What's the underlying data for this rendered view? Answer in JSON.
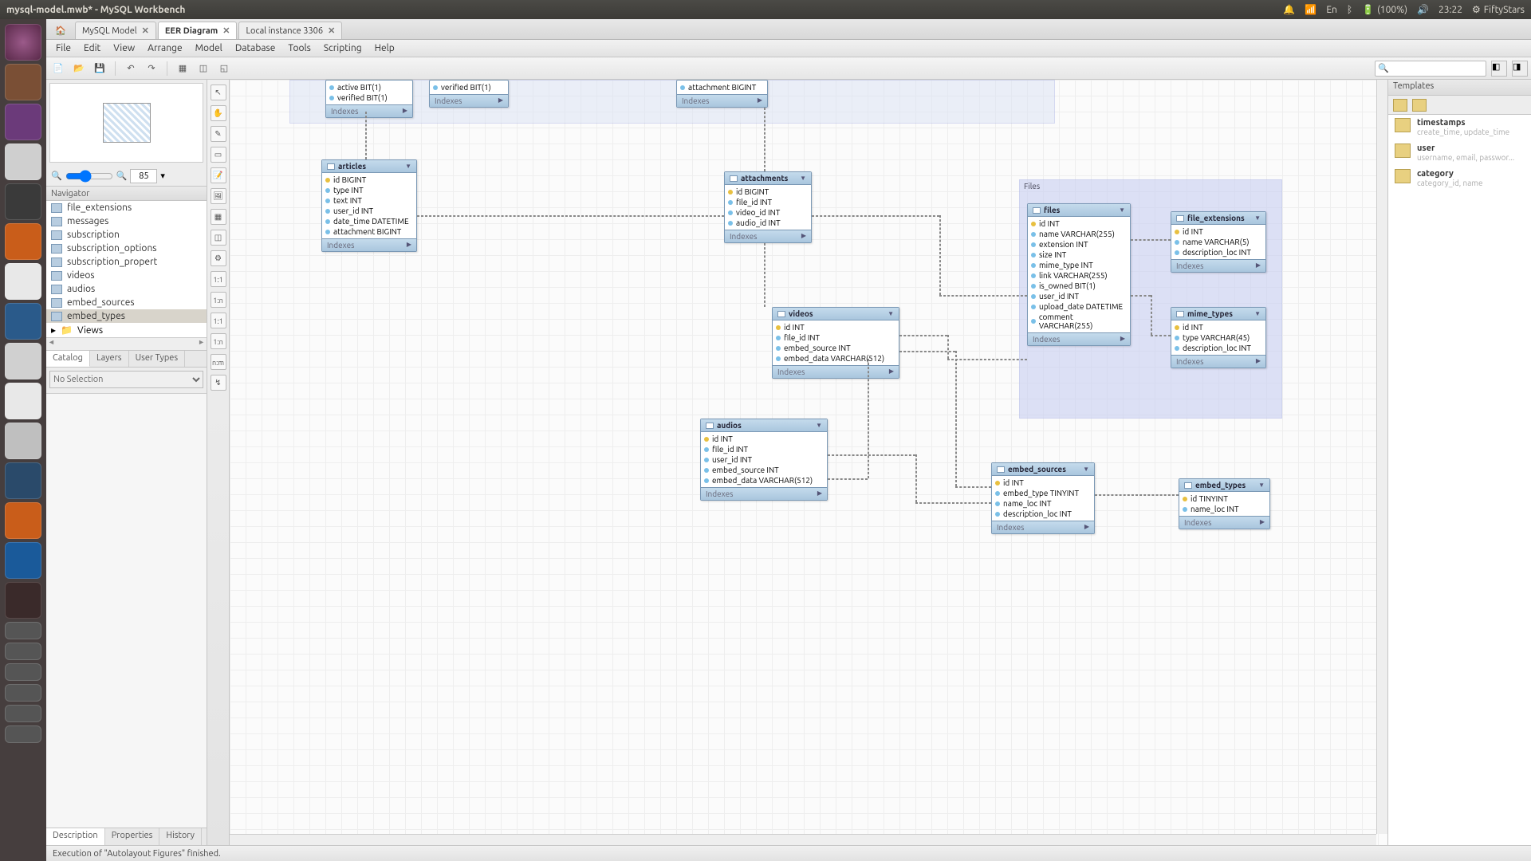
{
  "window_title": "mysql-model.mwb* - MySQL Workbench",
  "panel": {
    "battery": "(100%)",
    "time": "23:22",
    "lang": "En",
    "user": "FiftyStars"
  },
  "tabs": [
    {
      "label": "MySQL Model",
      "active": false
    },
    {
      "label": "EER Diagram",
      "active": true
    },
    {
      "label": "Local instance 3306",
      "active": false
    }
  ],
  "menu": [
    "File",
    "Edit",
    "View",
    "Arrange",
    "Model",
    "Database",
    "Tools",
    "Scripting",
    "Help"
  ],
  "zoom_value": "85",
  "navigator_label": "Navigator",
  "nav_items": [
    "file_extensions",
    "messages",
    "subscription",
    "subscription_options",
    "subscription_propert",
    "videos",
    "audios",
    "embed_sources",
    "embed_types"
  ],
  "nav_selected": "embed_types",
  "nav_views_label": "Views",
  "nav_tabs": [
    "Catalog",
    "Layers",
    "User Types"
  ],
  "nav_tab_active": "Catalog",
  "selection_label": "No Selection",
  "bottom_tabs": [
    "Description",
    "Properties",
    "History"
  ],
  "bottom_tab_active": "Description",
  "status_text": "Execution of \"Autolayout Figures\" finished.",
  "vtool_labels": [
    "1:1",
    "1:n",
    "1:1",
    "1:n",
    "n:m",
    ""
  ],
  "templates_header": "Templates",
  "templates": [
    {
      "name": "timestamps",
      "desc": "create_time, update_time"
    },
    {
      "name": "user",
      "desc": "username, email, passwor..."
    },
    {
      "name": "category",
      "desc": "category_id, name"
    }
  ],
  "layer_label": "Files",
  "indexes_label": "Indexes",
  "tables": {
    "frag1": {
      "cols": [
        "active BIT(1)",
        "verified BIT(1)"
      ]
    },
    "frag2": {
      "cols": [
        "verified BIT(1)"
      ]
    },
    "frag3": {
      "cols": [
        "attachment BIGINT"
      ]
    },
    "articles": {
      "name": "articles",
      "cols": [
        {
          "k": "key",
          "t": "id BIGINT"
        },
        {
          "k": "fld",
          "t": "type INT"
        },
        {
          "k": "fld",
          "t": "text INT"
        },
        {
          "k": "fld",
          "t": "user_id INT"
        },
        {
          "k": "fld",
          "t": "date_time DATETIME"
        },
        {
          "k": "fld",
          "t": "attachment BIGINT"
        }
      ]
    },
    "attachments": {
      "name": "attachments",
      "cols": [
        {
          "k": "key",
          "t": "id BIGINT"
        },
        {
          "k": "fld",
          "t": "file_id INT"
        },
        {
          "k": "fld",
          "t": "video_id INT"
        },
        {
          "k": "fld",
          "t": "audio_id INT"
        }
      ]
    },
    "videos": {
      "name": "videos",
      "cols": [
        {
          "k": "key",
          "t": "id INT"
        },
        {
          "k": "fld",
          "t": "file_id INT"
        },
        {
          "k": "fld",
          "t": "embed_source INT"
        },
        {
          "k": "fld",
          "t": "embed_data VARCHAR(512)"
        }
      ]
    },
    "audios": {
      "name": "audios",
      "cols": [
        {
          "k": "key",
          "t": "id INT"
        },
        {
          "k": "fld",
          "t": "file_id INT"
        },
        {
          "k": "fld",
          "t": "user_id INT"
        },
        {
          "k": "fld",
          "t": "embed_source INT"
        },
        {
          "k": "fld",
          "t": "embed_data VARCHAR(512)"
        }
      ]
    },
    "files": {
      "name": "files",
      "cols": [
        {
          "k": "key",
          "t": "id INT"
        },
        {
          "k": "fld",
          "t": "name VARCHAR(255)"
        },
        {
          "k": "fld",
          "t": "extension INT"
        },
        {
          "k": "fld",
          "t": "size INT"
        },
        {
          "k": "fld",
          "t": "mime_type INT"
        },
        {
          "k": "fld",
          "t": "link VARCHAR(255)"
        },
        {
          "k": "fld",
          "t": "is_owned BIT(1)"
        },
        {
          "k": "fld",
          "t": "user_id INT"
        },
        {
          "k": "fld",
          "t": "upload_date DATETIME"
        },
        {
          "k": "fld",
          "t": "comment VARCHAR(255)"
        }
      ]
    },
    "file_extensions": {
      "name": "file_extensions",
      "cols": [
        {
          "k": "key",
          "t": "id INT"
        },
        {
          "k": "fld",
          "t": "name VARCHAR(5)"
        },
        {
          "k": "fld",
          "t": "description_loc INT"
        }
      ]
    },
    "mime_types": {
      "name": "mime_types",
      "cols": [
        {
          "k": "key",
          "t": "id INT"
        },
        {
          "k": "fld",
          "t": "type VARCHAR(45)"
        },
        {
          "k": "fld",
          "t": "description_loc INT"
        }
      ]
    },
    "embed_sources": {
      "name": "embed_sources",
      "cols": [
        {
          "k": "key",
          "t": "id INT"
        },
        {
          "k": "fld",
          "t": "embed_type TINYINT"
        },
        {
          "k": "fld",
          "t": "name_loc INT"
        },
        {
          "k": "fld",
          "t": "description_loc INT"
        }
      ]
    },
    "embed_types": {
      "name": "embed_types",
      "cols": [
        {
          "k": "key",
          "t": "id TINYINT"
        },
        {
          "k": "fld",
          "t": "name_loc INT"
        }
      ]
    }
  }
}
